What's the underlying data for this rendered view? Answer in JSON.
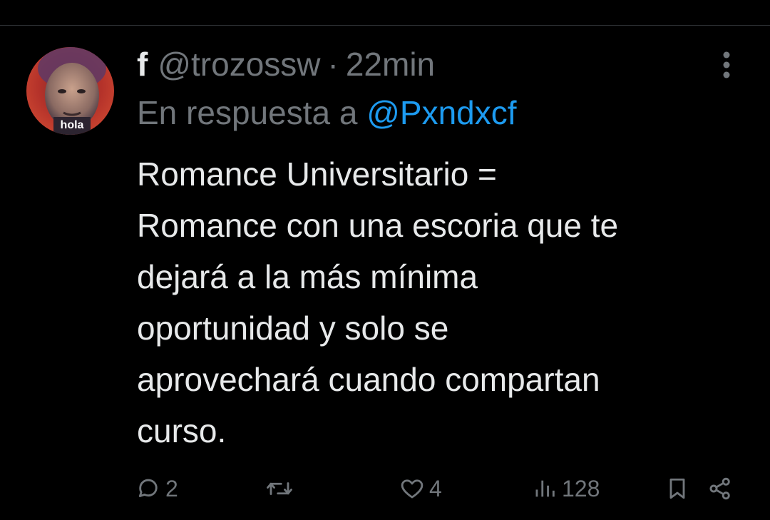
{
  "tweet": {
    "author": {
      "display_name": "f",
      "handle": "@trozossw",
      "avatar_text": "hola"
    },
    "separator": "·",
    "time": "22min",
    "reply_prefix": "En respuesta a",
    "reply_to": "@Pxndxcf",
    "text": "Romance Universitario =\nRomance con una escoria que te\ndejará a la más mínima\noportunidad y solo se\naprovechará cuando compartan\ncurso."
  },
  "actions": {
    "replies": "2",
    "likes": "4",
    "views": "128"
  },
  "colors": {
    "background": "#000000",
    "text": "#e7e9ea",
    "secondary": "#71767b",
    "link": "#1d9bf0",
    "divider": "#2f3336"
  },
  "icons": {
    "reply": "reply-icon",
    "retweet": "retweet-icon",
    "like": "heart-icon",
    "views": "views-icon",
    "bookmark": "bookmark-icon",
    "share": "share-icon",
    "more": "more-icon"
  }
}
